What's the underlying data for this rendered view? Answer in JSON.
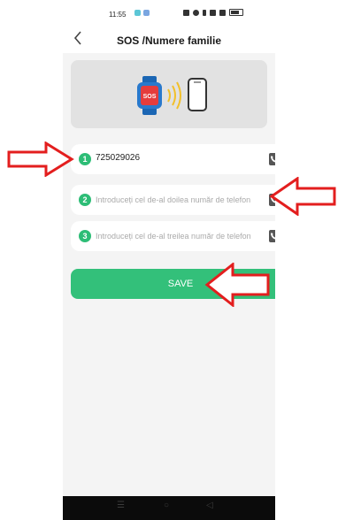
{
  "status_bar": {
    "time": "11:55"
  },
  "header": {
    "back_icon": "chevron-left-icon",
    "title": "SOS /Numere familie"
  },
  "hero": {
    "badge_text": "SOS",
    "watch_icon": "smartwatch-icon",
    "phone_icon": "smartphone-icon"
  },
  "contacts": [
    {
      "index": "1",
      "value": "725029026",
      "placeholder": ""
    },
    {
      "index": "2",
      "value": "",
      "placeholder": "Introduceți cel de-al doilea număr de telefon"
    },
    {
      "index": "3",
      "value": "",
      "placeholder": "Introduceți cel de-al treilea număr de telefon"
    }
  ],
  "save_button": {
    "label": "SAVE"
  },
  "colors": {
    "accent": "#33c07a",
    "annotation_arrow": "#e31e1e"
  }
}
